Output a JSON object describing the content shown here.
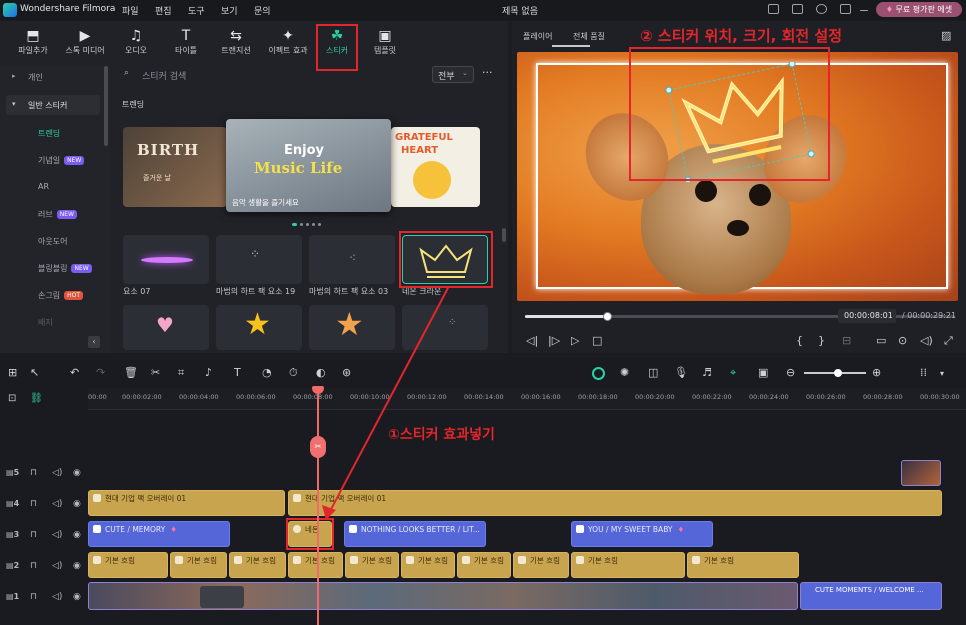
{
  "titlebar": {
    "app_name": "Wondershare Filmora",
    "menu": [
      "파일",
      "편집",
      "도구",
      "보기",
      "문의"
    ],
    "project_title": "제목 없음",
    "purchase_label": "무료 평가판 에셋"
  },
  "toolbar": {
    "items": [
      {
        "label": "파일추가",
        "icon": "import-icon"
      },
      {
        "label": "스톡 미디어",
        "icon": "stock-media-icon"
      },
      {
        "label": "오디오",
        "icon": "music-note-icon"
      },
      {
        "label": "타이틀",
        "icon": "title-t-icon"
      },
      {
        "label": "트랜지션",
        "icon": "transition-arrows-icon"
      },
      {
        "label": "이펙트 효과",
        "icon": "effects-sparkle-icon"
      },
      {
        "label": "스티커",
        "icon": "sticker-icon"
      },
      {
        "label": "템플릿",
        "icon": "template-icon"
      }
    ],
    "active_index": 6
  },
  "sidebar": {
    "personal": "개인",
    "general": "일반 스티커",
    "items": [
      {
        "label": "트렌딩",
        "badge": ""
      },
      {
        "label": "기념일",
        "badge": "NEW"
      },
      {
        "label": "AR",
        "badge": ""
      },
      {
        "label": "러브",
        "badge": "NEW"
      },
      {
        "label": "아웃도어",
        "badge": ""
      },
      {
        "label": "블링블링",
        "badge": "NEW"
      },
      {
        "label": "손그림",
        "badge": "HOT"
      },
      {
        "label": "배지",
        "badge": ""
      }
    ]
  },
  "search": {
    "placeholder": "스티커 검색",
    "filter": "전부",
    "more": "···"
  },
  "trending": {
    "section_label": "트렌딩",
    "banner_center_title_1": "Enjoy",
    "banner_center_title_2": "Music Life",
    "banner_center_caption": "음악 생활을 즐기세요",
    "banner_left_text": "BIRTH",
    "banner_left_caption": "즐거운 날",
    "banner_right_text_1": "GRATEFUL",
    "banner_right_text_2": "HEART"
  },
  "stickers": [
    {
      "label": "요소 07"
    },
    {
      "label": "마법의 하트 팩 요소 19"
    },
    {
      "label": "마법의 하트 팩 요소 03"
    },
    {
      "label": "네온 크라운"
    }
  ],
  "player": {
    "tabs": [
      "플레이어",
      "전체 품질"
    ],
    "current_time": "00:00:08:01",
    "total_time": "/ 00:00:29:21",
    "progress_fraction": 0.19
  },
  "timeline": {
    "ruler": [
      "00:00",
      "00:00:02:00",
      "00:00:04:00",
      "00:00:06:00",
      "00:00:08:00",
      "00:00:10:00",
      "00:00:12:00",
      "00:00:14:00",
      "00:00:16:00",
      "00:00:18:00",
      "00:00:20:00",
      "00:00:22:00",
      "00:00:24:00",
      "00:00:26:00",
      "00:00:28:00",
      "00:00:30:00"
    ],
    "track_numbers": [
      "5",
      "4",
      "3",
      "2",
      "1"
    ],
    "track4_clips": [
      "현대 기업 팩 오버레이 01",
      "현대 기업 팩 오버레이 01"
    ],
    "track3_clips": [
      "CUTE / MEMORY",
      "네온",
      "NOTHING LOOKS BETTER / LIT...",
      "YOU / MY SWEET BABY"
    ],
    "track2_clip": "기본 흐림",
    "track1_last": "CUTE MOMENTS / WELCOME ..."
  },
  "annotations": {
    "step1": "①스티커 효과넣기",
    "step2": "② 스티커 위치, 크기, 회전 설정"
  },
  "colors": {
    "accent": "#2ad1a6",
    "annotation": "#e3262b",
    "clip_gold": "#c9a44e",
    "clip_blue": "#5466d8",
    "playhead": "#f06a6a"
  }
}
